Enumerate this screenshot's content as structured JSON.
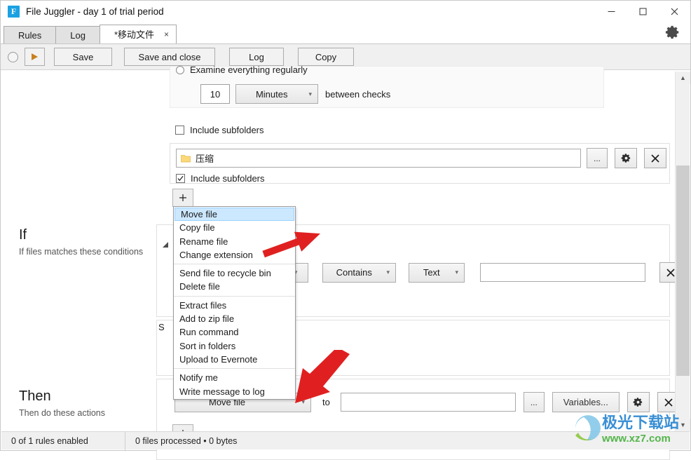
{
  "window": {
    "title": "File Juggler - day 1 of trial period",
    "logo_letter": "F",
    "logo_color": "#1ba1e2",
    "minimize": "minimize-icon",
    "maximize": "maximize-icon",
    "close": "close-icon"
  },
  "tabs": [
    {
      "label": "Rules",
      "active": false,
      "closable": false
    },
    {
      "label": "Log",
      "active": false,
      "closable": false
    },
    {
      "label": "*移动文件",
      "active": true,
      "closable": true,
      "close_glyph": "×"
    }
  ],
  "settings_gear": "gear-icon",
  "toolbar": {
    "status_radio": "run-status-indicator",
    "play_label": "play-icon",
    "save_label": "Save",
    "save_and_close_label": "Save and close",
    "log_label": "Log",
    "copy_label": "Copy"
  },
  "watch": {
    "examine_option_label": "Examine everything regularly",
    "examine_selected": false,
    "interval_value": "10",
    "interval_unit": "Minutes",
    "interval_suffix": "between checks",
    "include_subfolders_1": {
      "label": "Include subfolders",
      "checked": false
    },
    "folder_row": {
      "folder_name": "压缩",
      "browse_label": "...",
      "settings_icon": "gear-icon",
      "remove_icon": "close-icon"
    },
    "include_subfolders_2": {
      "label": "Include subfolders",
      "checked": true
    },
    "add_button_label": "+"
  },
  "if_section": {
    "heading": "If",
    "subtitle": "If files matches these conditions",
    "condition": {
      "field_chevron": "chevron-down-icon",
      "operator": "Contains",
      "value_type": "Text",
      "value": "",
      "remove_icon": "close-icon"
    },
    "hidden_button_label": "S"
  },
  "then_section": {
    "heading": "Then",
    "subtitle": "Then do these actions",
    "action": {
      "action_label": "Move file",
      "to_label": "to",
      "destination_value": "",
      "browse_label": "...",
      "variables_label": "Variables...",
      "settings_icon": "gear-icon",
      "remove_icon": "close-icon"
    },
    "add_button_label": "+"
  },
  "action_menu": {
    "open": true,
    "groups": [
      [
        "Move file",
        "Copy file",
        "Rename file",
        "Change extension"
      ],
      [
        "Send file to recycle bin",
        "Delete file"
      ],
      [
        "Extract files",
        "Add to zip file",
        "Run command",
        "Sort in folders",
        "Upload to Evernote"
      ],
      [
        "Notify me",
        "Write message to log"
      ]
    ],
    "selected": "Move file",
    "highlight_color": "#cce8ff"
  },
  "statusbar": {
    "rules_enabled": "0 of 1 rules enabled",
    "files_processed": "0 files processed • 0 bytes"
  },
  "watermark": {
    "title": "极光下载站",
    "url": "www.xz7.com"
  },
  "annotations": {
    "arrow_color": "#e02020",
    "arrow_1_target": "action-type-dropdown-menu",
    "arrow_2_target": "then-action-dropdown"
  }
}
